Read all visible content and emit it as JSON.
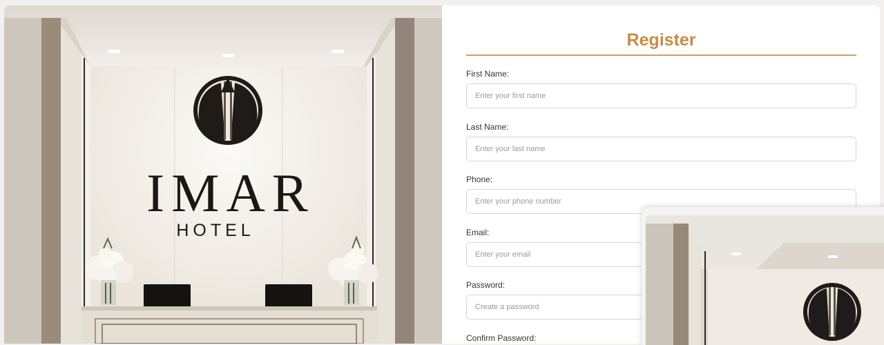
{
  "hotel": {
    "logo_name": "IMAR",
    "logo_sub": "HOTEL"
  },
  "form": {
    "title": "Register",
    "fields": [
      {
        "label": "First Name:",
        "placeholder": "Enter your first name"
      },
      {
        "label": "Last Name:",
        "placeholder": "Enter your last name"
      },
      {
        "label": "Phone:",
        "placeholder": "Enter your phone number"
      },
      {
        "label": "Email:",
        "placeholder": "Enter your email"
      },
      {
        "label": "Password:",
        "placeholder": "Create a password"
      },
      {
        "label": "Confirm Password:",
        "placeholder": ""
      }
    ]
  },
  "colors": {
    "accent": "#c98a45",
    "rule": "#c9a066",
    "wall": "#ece7df",
    "pillar": "#8e7f70"
  }
}
